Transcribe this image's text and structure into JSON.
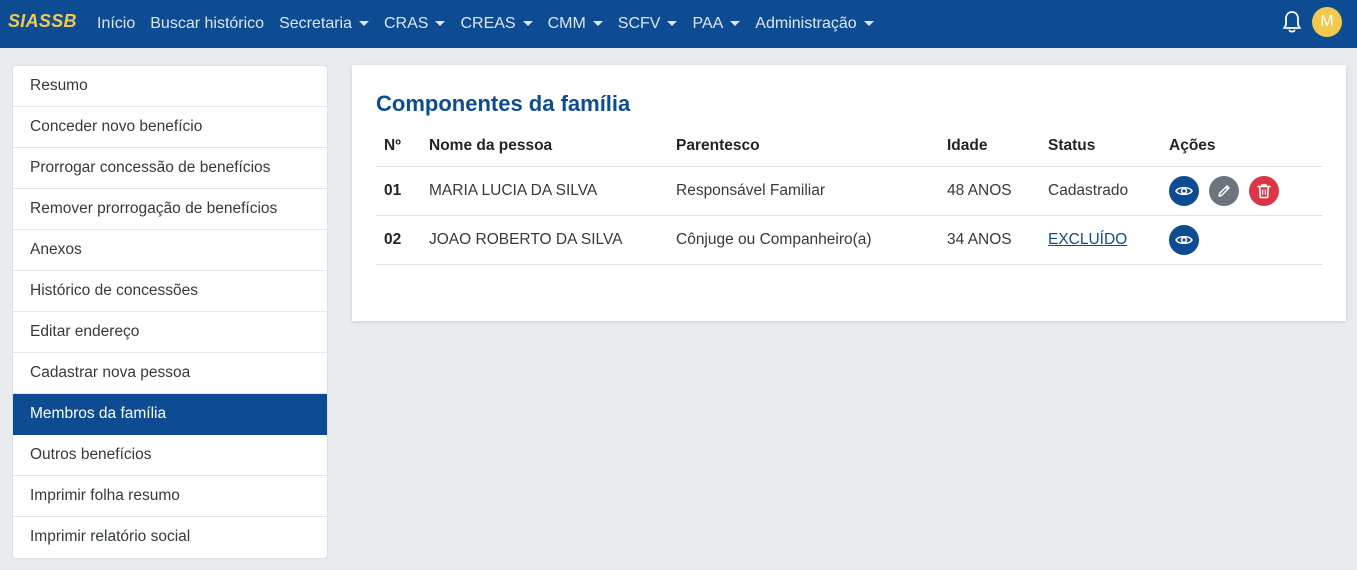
{
  "navbar": {
    "brand": "SIASSB",
    "items": [
      {
        "label": "Início",
        "dropdown": false
      },
      {
        "label": "Buscar histórico",
        "dropdown": false
      },
      {
        "label": "Secretaria",
        "dropdown": true
      },
      {
        "label": "CRAS",
        "dropdown": true
      },
      {
        "label": "CREAS",
        "dropdown": true
      },
      {
        "label": "CMM",
        "dropdown": true
      },
      {
        "label": "SCFV",
        "dropdown": true
      },
      {
        "label": "PAA",
        "dropdown": true
      },
      {
        "label": "Administração",
        "dropdown": true
      }
    ],
    "notifications_icon": "bell-icon",
    "avatar_initial": "M"
  },
  "sidebar": {
    "items": [
      {
        "label": "Resumo",
        "active": false
      },
      {
        "label": "Conceder novo benefício",
        "active": false
      },
      {
        "label": "Prorrogar concessão de benefícios",
        "active": false
      },
      {
        "label": "Remover prorrogação de benefícios",
        "active": false
      },
      {
        "label": "Anexos",
        "active": false
      },
      {
        "label": "Histórico de concessões",
        "active": false
      },
      {
        "label": "Editar endereço",
        "active": false
      },
      {
        "label": "Cadastrar nova pessoa",
        "active": false
      },
      {
        "label": "Membros da família",
        "active": true
      },
      {
        "label": "Outros benefícios",
        "active": false
      },
      {
        "label": "Imprimir folha resumo",
        "active": false
      },
      {
        "label": "Imprimir relatório social",
        "active": false
      }
    ]
  },
  "main": {
    "title": "Componentes da família",
    "table": {
      "headers": [
        "Nº",
        "Nome da pessoa",
        "Parentesco",
        "Idade",
        "Status",
        "Ações"
      ],
      "rows": [
        {
          "num": "01",
          "name": "MARIA LUCIA DA SILVA",
          "relation": "Responsável Familiar",
          "age": "48 ANOS",
          "status": "Cadastrado",
          "status_link": false,
          "actions": [
            "view",
            "edit",
            "delete"
          ]
        },
        {
          "num": "02",
          "name": "JOAO ROBERTO DA SILVA",
          "relation": "Cônjuge ou Companheiro(a)",
          "age": "34 ANOS",
          "status": "EXCLUÍDO",
          "status_link": true,
          "actions": [
            "view"
          ]
        }
      ]
    }
  },
  "colors": {
    "primary": "#0d4c93",
    "accent": "#f2c94c",
    "danger": "#dc3545",
    "secondary": "#6c757d"
  }
}
